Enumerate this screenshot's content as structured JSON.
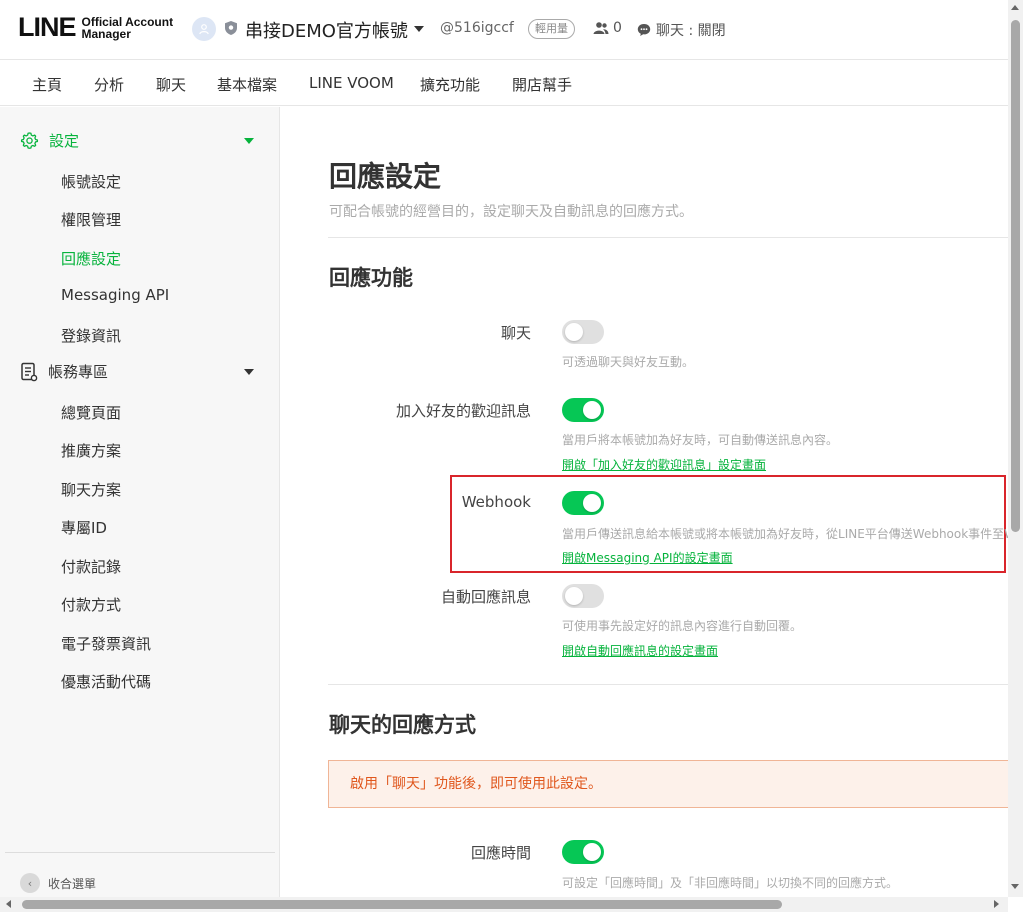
{
  "header": {
    "logo_main": "LINE",
    "logo_sub_line1": "Official Account",
    "logo_sub_line2": "Manager",
    "account_name": "串接DEMO官方帳號",
    "account_id": "@516igccf",
    "plan_badge": "輕用量",
    "friend_count": "0",
    "chat_status": "聊天 : 關閉"
  },
  "nav": {
    "items": [
      "主頁",
      "分析",
      "聊天",
      "基本檔案",
      "LINE VOOM",
      "擴充功能",
      "開店幫手"
    ]
  },
  "sidebar": {
    "settings_label": "設定",
    "settings_items": [
      "帳號設定",
      "權限管理",
      "回應設定",
      "Messaging API",
      "登錄資訊"
    ],
    "billing_label": "帳務專區",
    "billing_items": [
      "總覽頁面",
      "推廣方案",
      "聊天方案",
      "專屬ID",
      "付款記錄",
      "付款方式",
      "電子發票資訊",
      "優惠活動代碼"
    ],
    "collapse_label": "收合選單"
  },
  "main": {
    "title": "回應設定",
    "description": "可配合帳號的經營目的，設定聊天及自動訊息的回應方式。",
    "section_features": "回應功能",
    "chat": {
      "label": "聊天",
      "enabled": false,
      "desc": "可透過聊天與好友互動。"
    },
    "welcome": {
      "label": "加入好友的歡迎訊息",
      "enabled": true,
      "desc": "當用戶將本帳號加為好友時，可自動傳送訊息內容。",
      "link": "開啟「加入好友的歡迎訊息」設定畫面"
    },
    "webhook": {
      "label": "Webhook",
      "enabled": true,
      "desc": "當用戶傳送訊息給本帳號或將本帳號加為好友時，從LINE平台傳送Webhook事件至W",
      "link": "開啟Messaging API的設定畫面"
    },
    "auto_reply": {
      "label": "自動回應訊息",
      "enabled": false,
      "desc": "可使用事先設定好的訊息內容進行自動回覆。",
      "link": "開啟自動回應訊息的設定畫面"
    },
    "section_chat_response": "聊天的回應方式",
    "notice": "啟用「聊天」功能後，即可使用此設定。",
    "response_time": {
      "label": "回應時間",
      "enabled": true,
      "desc": "可設定「回應時間」及「非回應時間」以切換不同的回應方式。"
    }
  },
  "colors": {
    "brand_green": "#06c755",
    "active_green": "#06b33c",
    "highlight_red": "#d9252b",
    "notice_orange": "#e0571d"
  }
}
